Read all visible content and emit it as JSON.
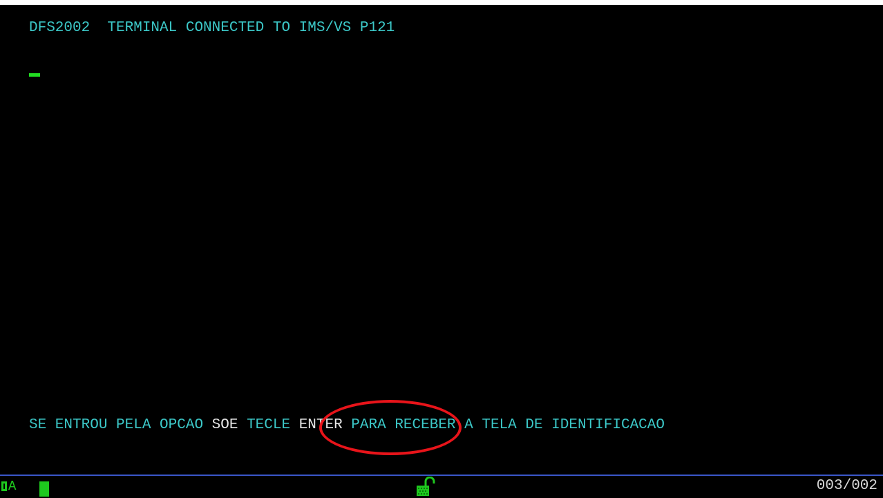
{
  "terminal": {
    "header_message": "DFS2002  TERMINAL CONNECTED TO IMS/VS P121",
    "instruction": {
      "part1": "SE ENTROU PELA OPCAO ",
      "highlight1": "SOE",
      "part2": " TECLE ",
      "highlight2": "ENTER",
      "part3": " PARA RECEBER A TELA DE IDENTIFICACAO"
    }
  },
  "status_bar": {
    "mode_indicator": "A",
    "lock_icon": "keyboard-unlocked-icon",
    "cursor_position": "003/002"
  },
  "colors": {
    "background": "#000000",
    "text_field": "#3cc8c8",
    "text_highlight": "#e8e8e8",
    "cursor": "#22dd22",
    "annotation": "#e8141a",
    "oia_line": "#3a56c8"
  }
}
